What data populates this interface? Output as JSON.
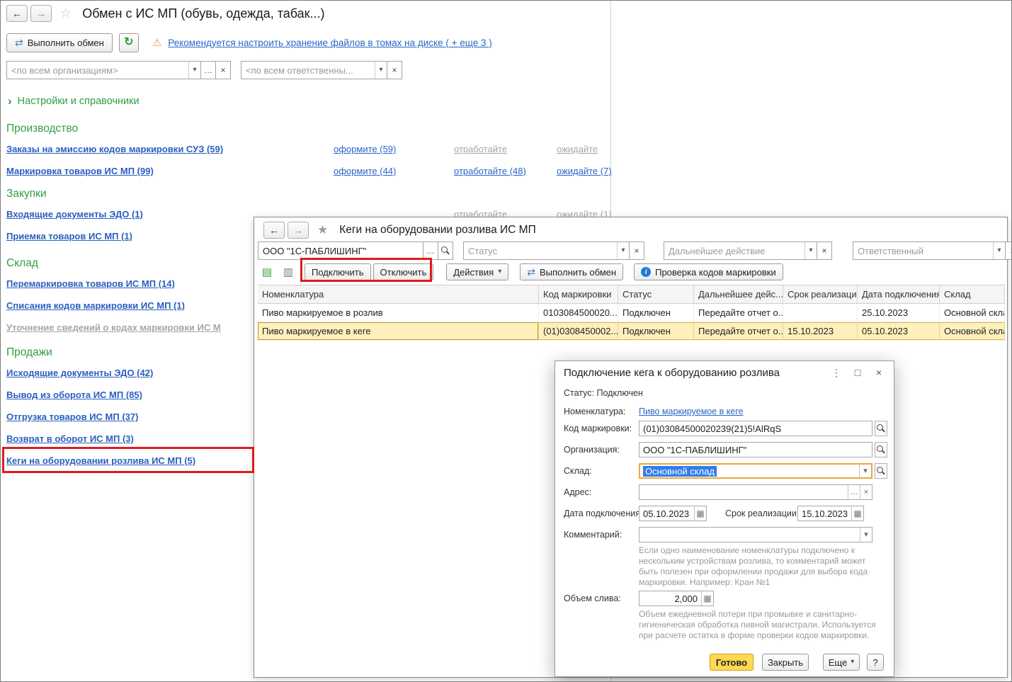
{
  "icons": {
    "back": "←",
    "forward": "→",
    "star_outline": "☆",
    "star_filled": "★",
    "sync": "⇄",
    "refresh": "↻",
    "warning": "⚠",
    "dropdown": "▾",
    "ellipsis": "…",
    "clear": "×",
    "chevron": "›",
    "calendar": "▦",
    "calculator": "▦",
    "list": "▤",
    "scanner": "▥",
    "more_vert": "⋮",
    "maximize": "□",
    "close": "×",
    "info": "i"
  },
  "main_window": {
    "title": "Обмен с ИС МП (обувь, одежда, табак...)",
    "exchange_button": "Выполнить обмен",
    "warning_link": "Рекомендуется настроить хранение файлов в томах на диске ( + еще 3 )",
    "org_filter_placeholder": "<по всем организациям>",
    "responsible_filter_placeholder": "<по всем ответственны...",
    "settings_link": "Настройки и справочники",
    "sections": [
      {
        "title": "Производство",
        "rows": [
          {
            "link": "Заказы на эмиссию кодов маркировки СУЗ (59)",
            "c2": "оформите (59)",
            "c3": "отработайте",
            "c4": "ожидайте"
          },
          {
            "link": "Маркировка товаров ИС МП (99)",
            "c2": "оформите (44)",
            "c3": "отработайте (48)",
            "c4": "ожидайте (7)"
          }
        ]
      },
      {
        "title": "Закупки",
        "rows": [
          {
            "link": "Входящие документы ЭДО (1)",
            "c3": "отработайте",
            "c4": "ожидайте (1)"
          },
          {
            "link": "Приемка товаров ИС МП (1)"
          }
        ]
      },
      {
        "title": "Склад",
        "rows": [
          {
            "link": "Перемаркировка товаров ИС МП (14)"
          },
          {
            "link": "Списания кодов маркировки ИС МП (1)"
          },
          {
            "link": "Уточнение сведений о кодах маркировки ИС М"
          }
        ]
      },
      {
        "title": "Продажи",
        "rows": [
          {
            "link": "Исходящие документы ЭДО (42)"
          },
          {
            "link": "Вывод из оборота ИС МП (85)"
          },
          {
            "link": "Отгрузка товаров ИС МП (37)"
          },
          {
            "link": "Возврат в оборот ИС МП (3)"
          },
          {
            "link": "Кеги на оборудовании розлива ИС МП (5)"
          }
        ]
      }
    ]
  },
  "list_window": {
    "title": "Кеги на оборудовании розлива ИС МП",
    "filters": {
      "org_value": "ООО \"1С-ПАБЛИШИНГ\"",
      "status_placeholder": "Статус",
      "action_placeholder": "Дальнейшее действие",
      "responsible_placeholder": "Ответственный"
    },
    "toolbar": {
      "connect": "Подключить",
      "disconnect": "Отключить",
      "actions": "Действия",
      "exchange": "Выполнить обмен",
      "check_codes": "Проверка кодов маркировки"
    },
    "table": {
      "columns": [
        "Номенклатура",
        "Код маркировки",
        "Статус",
        "Дальнейшее дейс...",
        "Срок реализации",
        "Дата подключения",
        "Склад"
      ],
      "rows": [
        [
          "Пиво маркируемое в розлив",
          "0103084500020...",
          "Подключен",
          "Передайте отчет о...",
          "",
          "25.10.2023",
          "Основной склад"
        ],
        [
          "Пиво маркируемое в кеге",
          "(01)0308450002...",
          "Подключен",
          "Передайте отчет о...",
          "15.10.2023",
          "05.10.2023",
          "Основной склад"
        ]
      ]
    }
  },
  "dialog": {
    "title": "Подключение кега к оборудованию розлива",
    "status_label": "Статус:",
    "status_value": "Подключен",
    "nomenclature_label": "Номенклатура:",
    "nomenclature_value": "Пиво маркируемое в кеге",
    "code_label": "Код маркировки:",
    "code_value": "(01)03084500020239(21)5!AlRqS",
    "org_label": "Организация:",
    "org_value": "ООО \"1С-ПАБЛИШИНГ\"",
    "warehouse_label": "Склад:",
    "warehouse_value": "Основной склад",
    "address_label": "Адрес:",
    "connect_date_label": "Дата подключения:",
    "connect_date_value": "05.10.2023",
    "expiry_label": "Срок реализации:",
    "expiry_value": "15.10.2023",
    "comment_label": "Комментарий:",
    "comment_hint": "Если одно наименование номенклатуры подключено к нескольким устройствам розлива, то комментарий может быть полезен при оформлении продажи для выбора кода маркировки. Например: Кран №1",
    "volume_label": "Объем слива:",
    "volume_value": "2,000",
    "volume_hint": "Объем ежедневной потери при промывке и санитарно-гигиеническая обработка пивной магистрали. Используется при расчете остатка в форме проверки кодов маркировки.",
    "buttons": {
      "done": "Готово",
      "close": "Закрыть",
      "more": "Еще",
      "help": "?"
    }
  }
}
